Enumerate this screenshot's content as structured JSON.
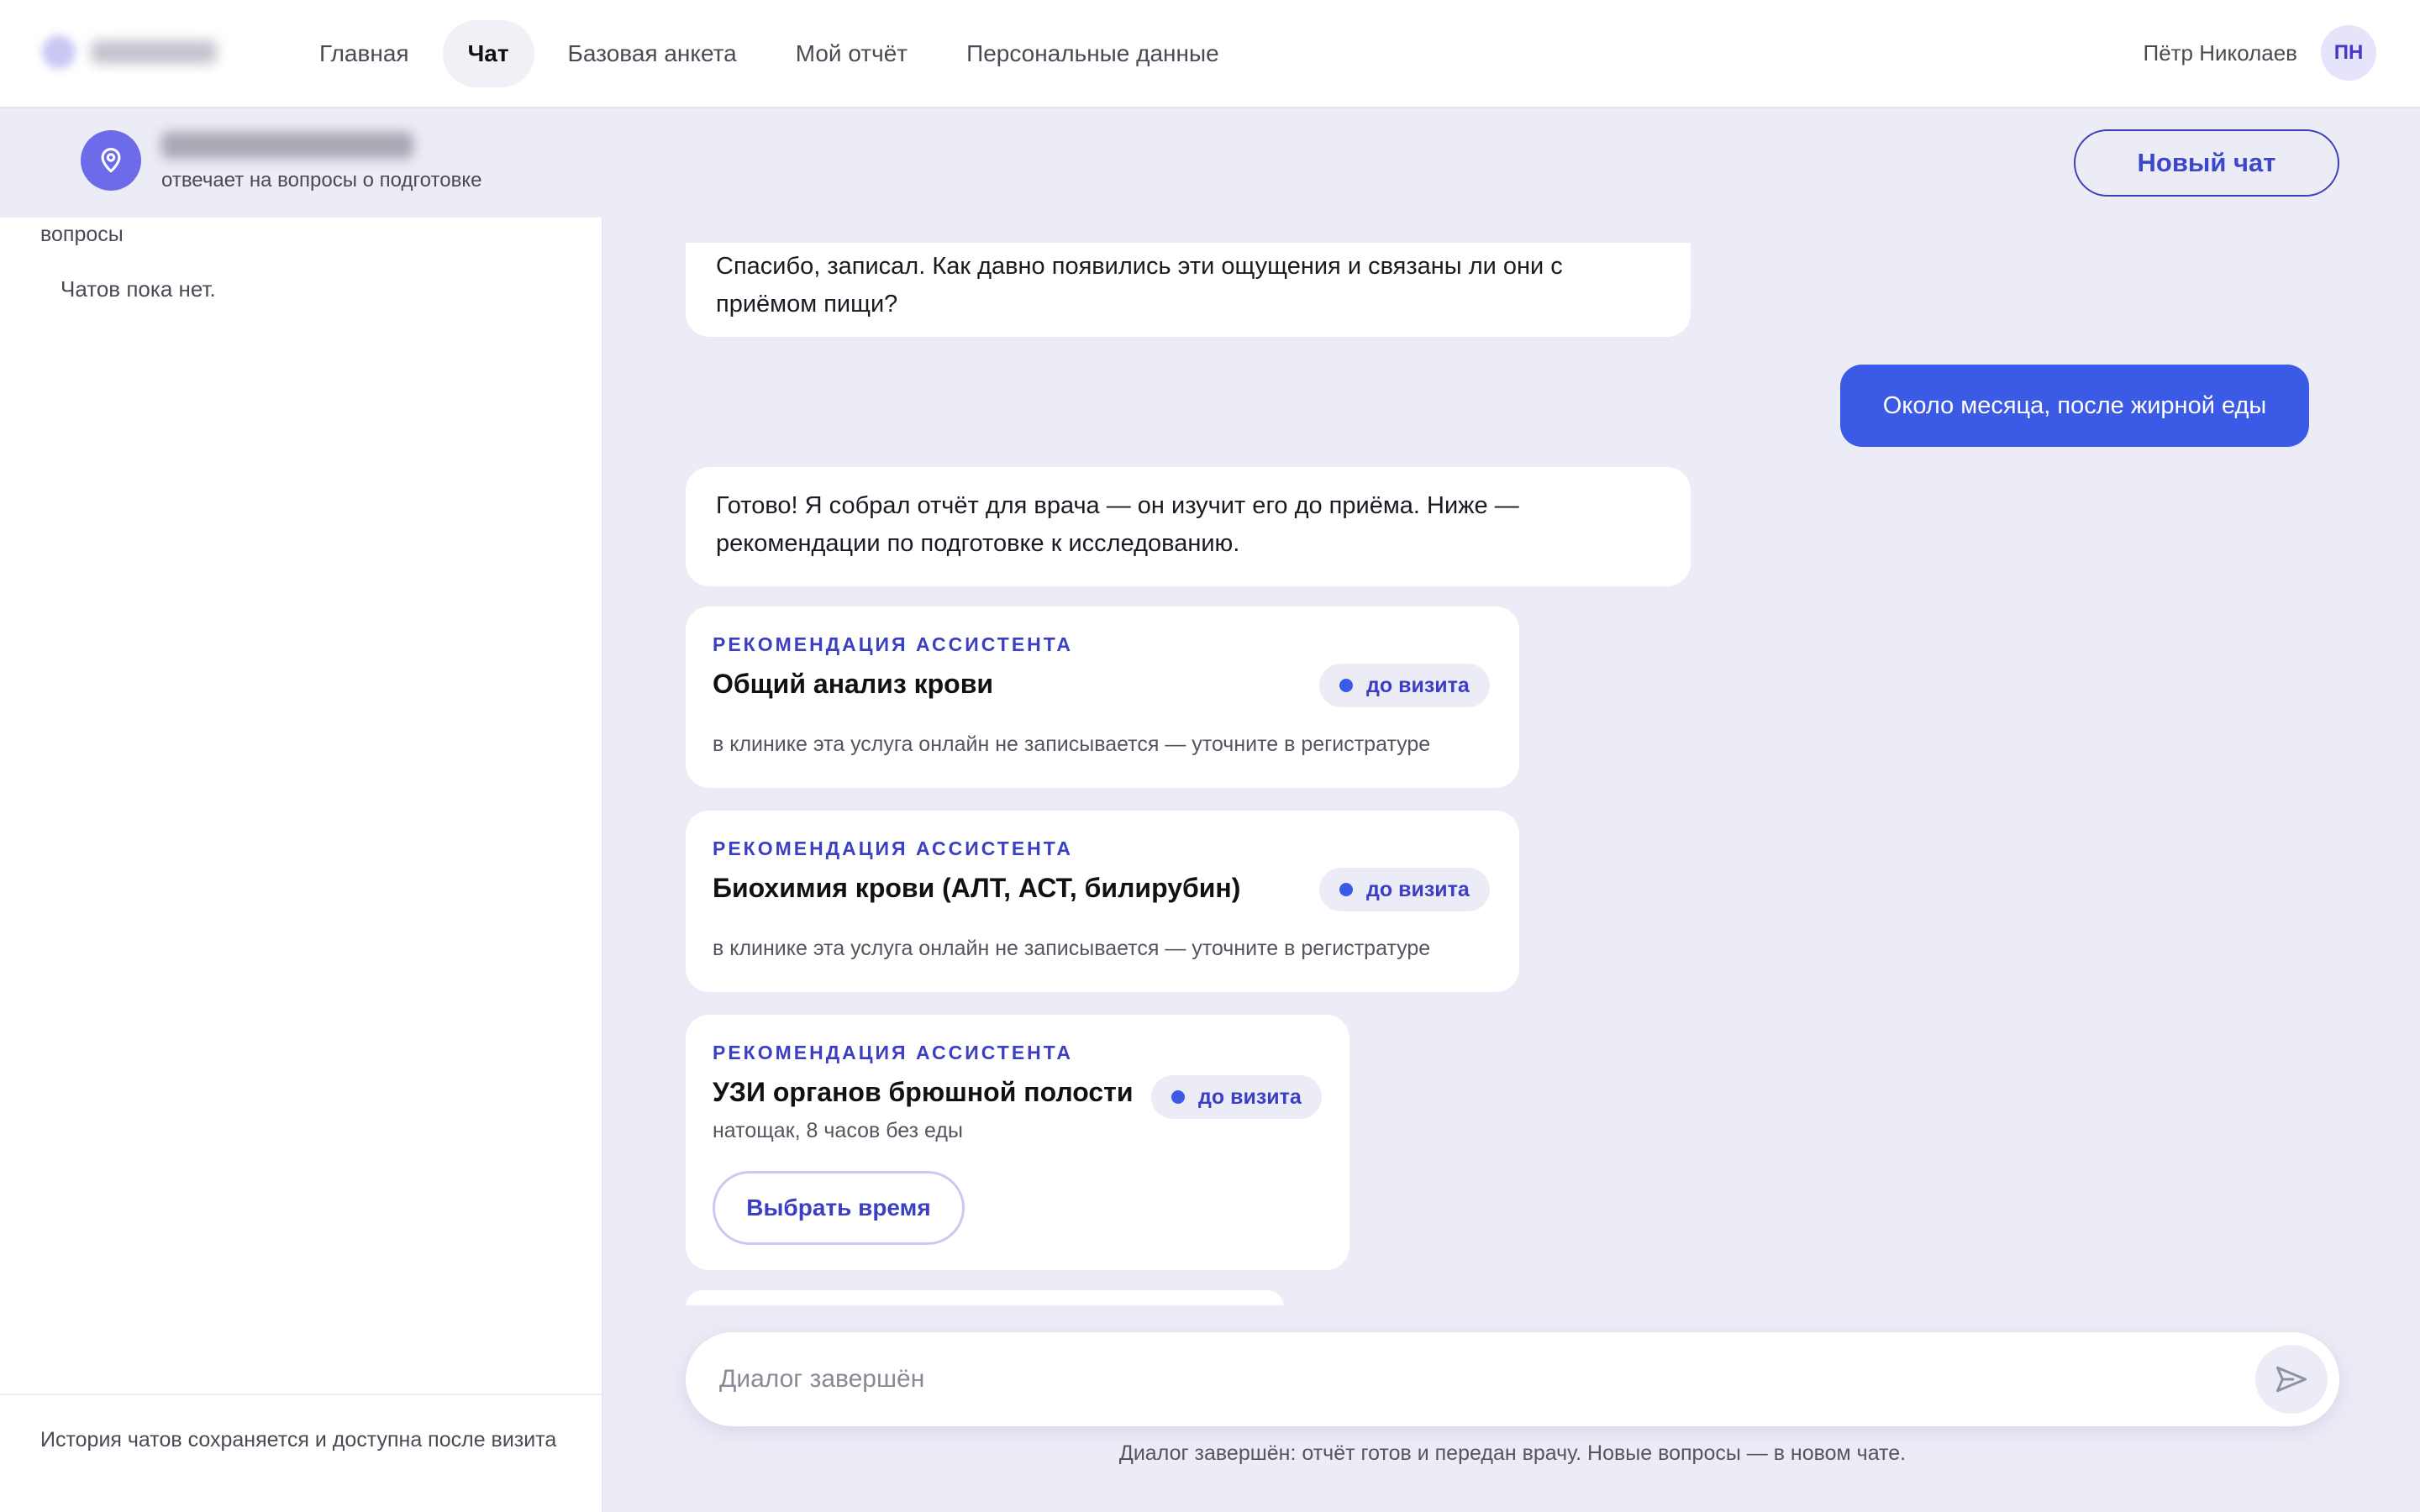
{
  "nav": {
    "items": [
      {
        "label": "Главная"
      },
      {
        "label": "Чат",
        "active": true
      },
      {
        "label": "Базовая анкета"
      },
      {
        "label": "Мой отчёт"
      },
      {
        "label": "Персональные данные"
      }
    ]
  },
  "user": {
    "name": "Пётр Николаев",
    "initials": "ПН"
  },
  "assistant": {
    "subtitle": "отвечает на вопросы о подготовке",
    "icon": "map-pin-icon",
    "new_chat_label": "Новый чат"
  },
  "sidebar": {
    "heading": "вопросы",
    "empty_text": "Чатов пока нет.",
    "footer": "История чатов сохраняется и доступна после визита"
  },
  "messages": {
    "bot_1": "Спасибо, записал. Как давно появились эти ощущения и связаны ли они с приёмом пищи?",
    "user_1": "Около месяца, после жирной еды",
    "bot_2": "Готово! Я собрал отчёт для врача — он изучит его до приёма. Ниже — рекомендации по подготовке к исследованию."
  },
  "recommendations": [
    {
      "kicker": "РЕКОМЕНДАЦИЯ АССИСТЕНТА",
      "title": "Общий анализ крови",
      "badge": "до визита",
      "note": "в клинике эта услуга онлайн не записывается — уточните в регистратуре"
    },
    {
      "kicker": "РЕКОМЕНДАЦИЯ АССИСТЕНТА",
      "title": "Биохимия крови (АЛТ, АСТ, билирубин)",
      "badge": "до визита",
      "note": "в клинике эта услуга онлайн не записывается — уточните в регистратуре"
    },
    {
      "kicker": "РЕКОМЕНДАЦИЯ АССИСТЕНТА",
      "title": "УЗИ органов брюшной полости",
      "badge": "до визита",
      "note": "натощак, 8 часов без еды",
      "action_label": "Выбрать время"
    }
  ],
  "composer": {
    "placeholder": "Диалог завершён",
    "send_icon": "send-icon"
  },
  "status_text": "Диалог завершён: отчёт готов и передан врачу. Новые вопросы — в новом чате.",
  "colors": {
    "accent": "#3b5be6",
    "accent_dark": "#3b3fc4",
    "background": "#ececf7"
  }
}
